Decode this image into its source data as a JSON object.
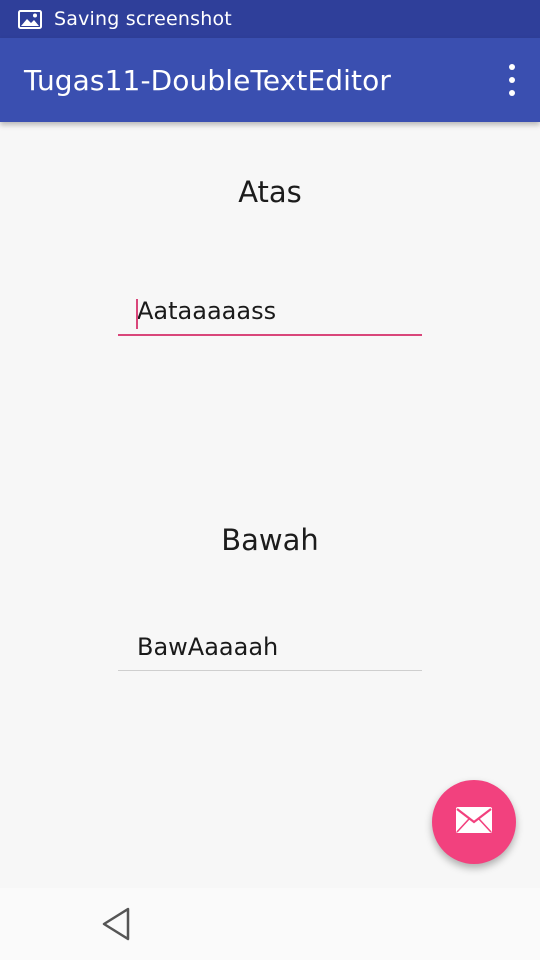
{
  "status_bar": {
    "notification_icon": "image-icon",
    "text": "Saving screenshot"
  },
  "app_bar": {
    "title": "Tugas11-DoubleTextEditor",
    "menu_icon": "more-vert-icon"
  },
  "main": {
    "top_label": "Atas",
    "top_input_value": "Aataaaaass",
    "bottom_label": "Bawah",
    "bottom_input_value": "BawAaaaah"
  },
  "fab": {
    "icon": "mail-icon"
  },
  "nav_bar": {
    "back_icon": "back-triangle-icon"
  },
  "colors": {
    "status_bar": "#2f3f9a",
    "app_bar": "#3a4fb0",
    "accent": "#f2417e",
    "background": "#f7f7f7"
  }
}
